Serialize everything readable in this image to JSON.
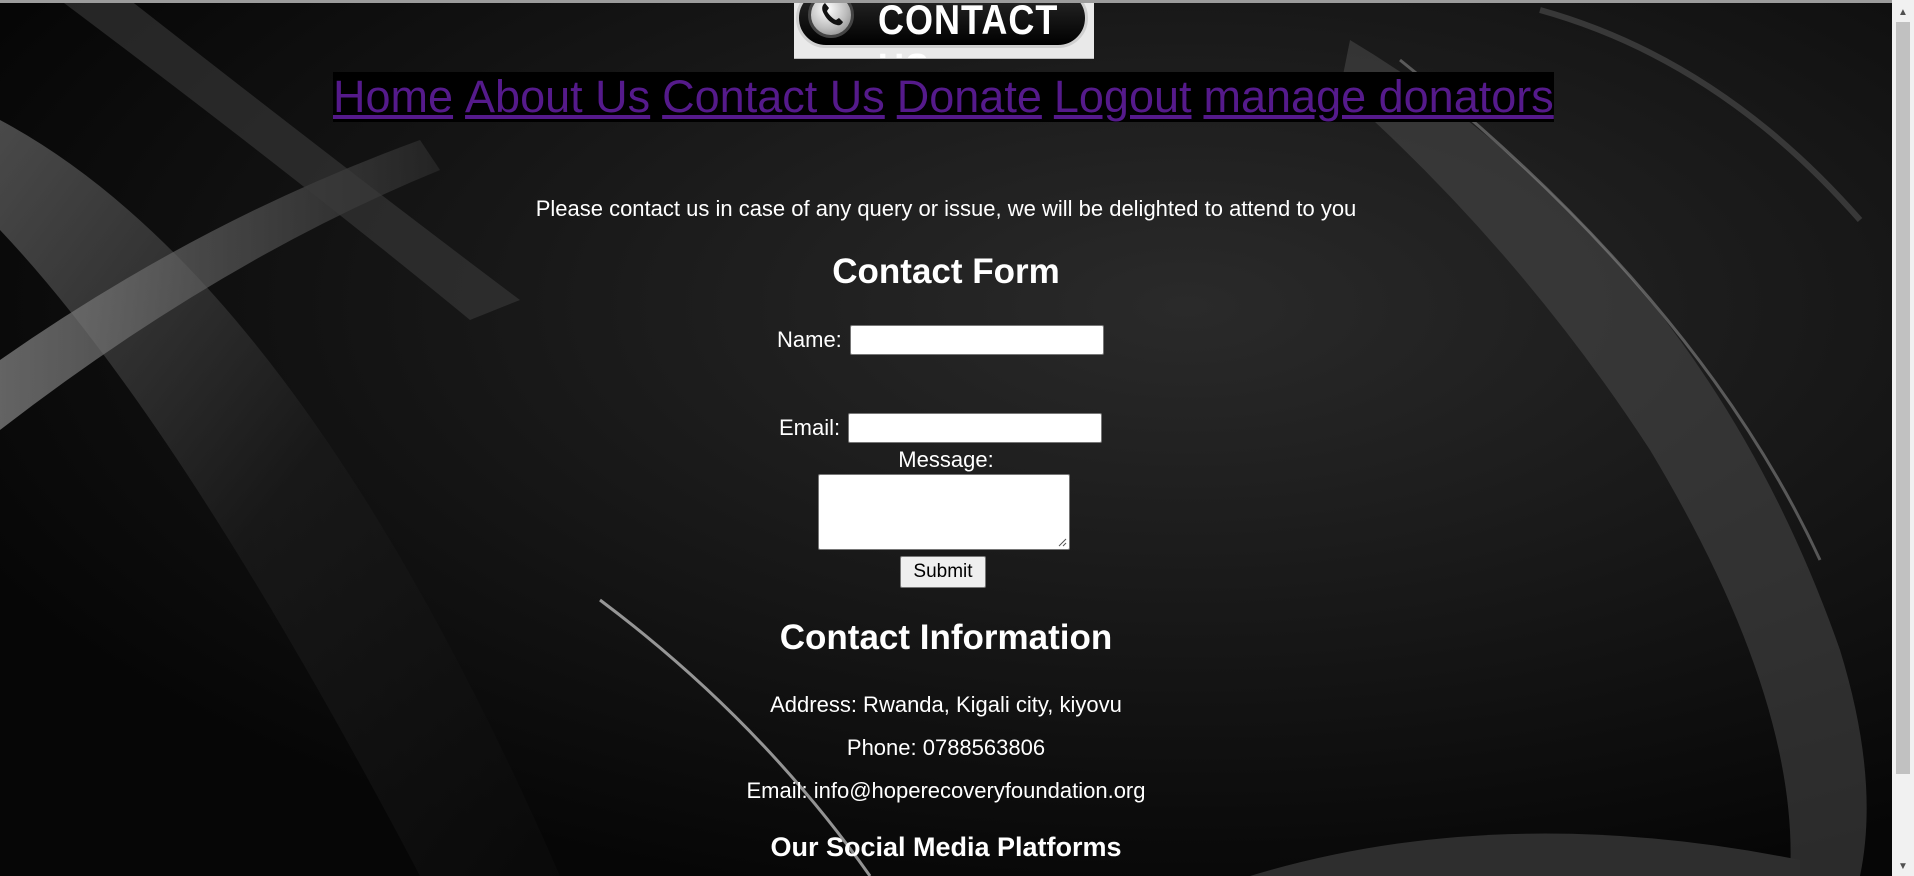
{
  "banner": {
    "text": "CONTACT US",
    "icon": "phone-icon"
  },
  "nav": {
    "items": [
      "Home",
      "About Us",
      "Contact Us",
      "Donate",
      "Logout",
      "manage donators"
    ]
  },
  "intro": "Please contact us in case of any query or issue, we will be delighted to attend to you",
  "contact_form": {
    "heading": "Contact Form",
    "name_label": "Name:",
    "name_value": "",
    "email_label": "Email:",
    "email_value": "",
    "message_label": "Message:",
    "message_value": "",
    "submit_label": "Submit"
  },
  "contact_info": {
    "heading": "Contact Information",
    "address": "Address: Rwanda, Kigali city, kiyovu",
    "phone": "Phone: 0788563806",
    "email": "Email: info@hoperecoveryfoundation.org"
  },
  "social": {
    "heading": "Our Social Media Platforms"
  },
  "colors": {
    "link": "#551a8b",
    "background": "#050505",
    "text": "#ffffff"
  }
}
